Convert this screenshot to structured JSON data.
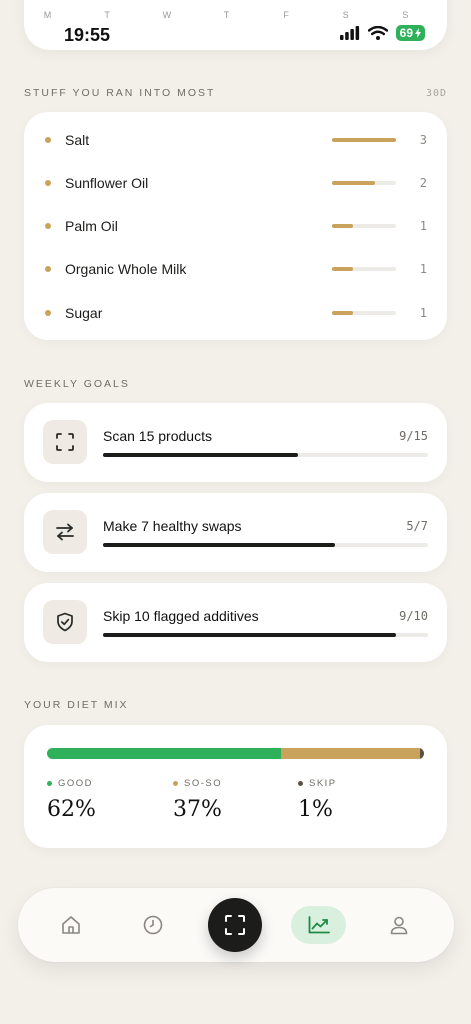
{
  "status_bar": {
    "week_days": [
      "M",
      "T",
      "W",
      "T",
      "F",
      "S",
      "S"
    ],
    "time": "19:55",
    "battery": "69"
  },
  "ingredients": {
    "title": "STUFF YOU RAN INTO MOST",
    "range": "30D",
    "accent_color": "#c9a25c",
    "items": [
      {
        "name": "Salt",
        "count": "3",
        "fraction": 1.0
      },
      {
        "name": "Sunflower Oil",
        "count": "2",
        "fraction": 0.67
      },
      {
        "name": "Palm Oil",
        "count": "1",
        "fraction": 0.33
      },
      {
        "name": "Organic Whole Milk",
        "count": "1",
        "fraction": 0.33
      },
      {
        "name": "Sugar",
        "count": "1",
        "fraction": 0.33
      }
    ]
  },
  "goals": {
    "title": "WEEKLY GOALS",
    "items": [
      {
        "icon": "scan-frame-icon",
        "label": "Scan 15 products",
        "progress": "9/15",
        "fraction": 0.6
      },
      {
        "icon": "swap-arrows-icon",
        "label": "Make 7 healthy swaps",
        "progress": "5/7",
        "fraction": 0.714
      },
      {
        "icon": "shield-check-icon",
        "label": "Skip 10 flagged additives",
        "progress": "9/10",
        "fraction": 0.9
      }
    ]
  },
  "diet_mix": {
    "title": "YOUR DIET MIX",
    "segments": [
      {
        "label": "GOOD",
        "pct": "62%",
        "value": 62,
        "color": "#2fb15b"
      },
      {
        "label": "SO-SO",
        "pct": "37%",
        "value": 37,
        "color": "#c9a25c"
      },
      {
        "label": "SKIP",
        "pct": "1%",
        "value": 1,
        "color": "#5a5247"
      }
    ]
  },
  "nav": {
    "items": [
      "home-icon",
      "history-clock-icon",
      "scan-icon",
      "stats-chart-icon",
      "profile-icon"
    ],
    "active": "stats-chart-icon",
    "active_color": "#2fb15b"
  }
}
